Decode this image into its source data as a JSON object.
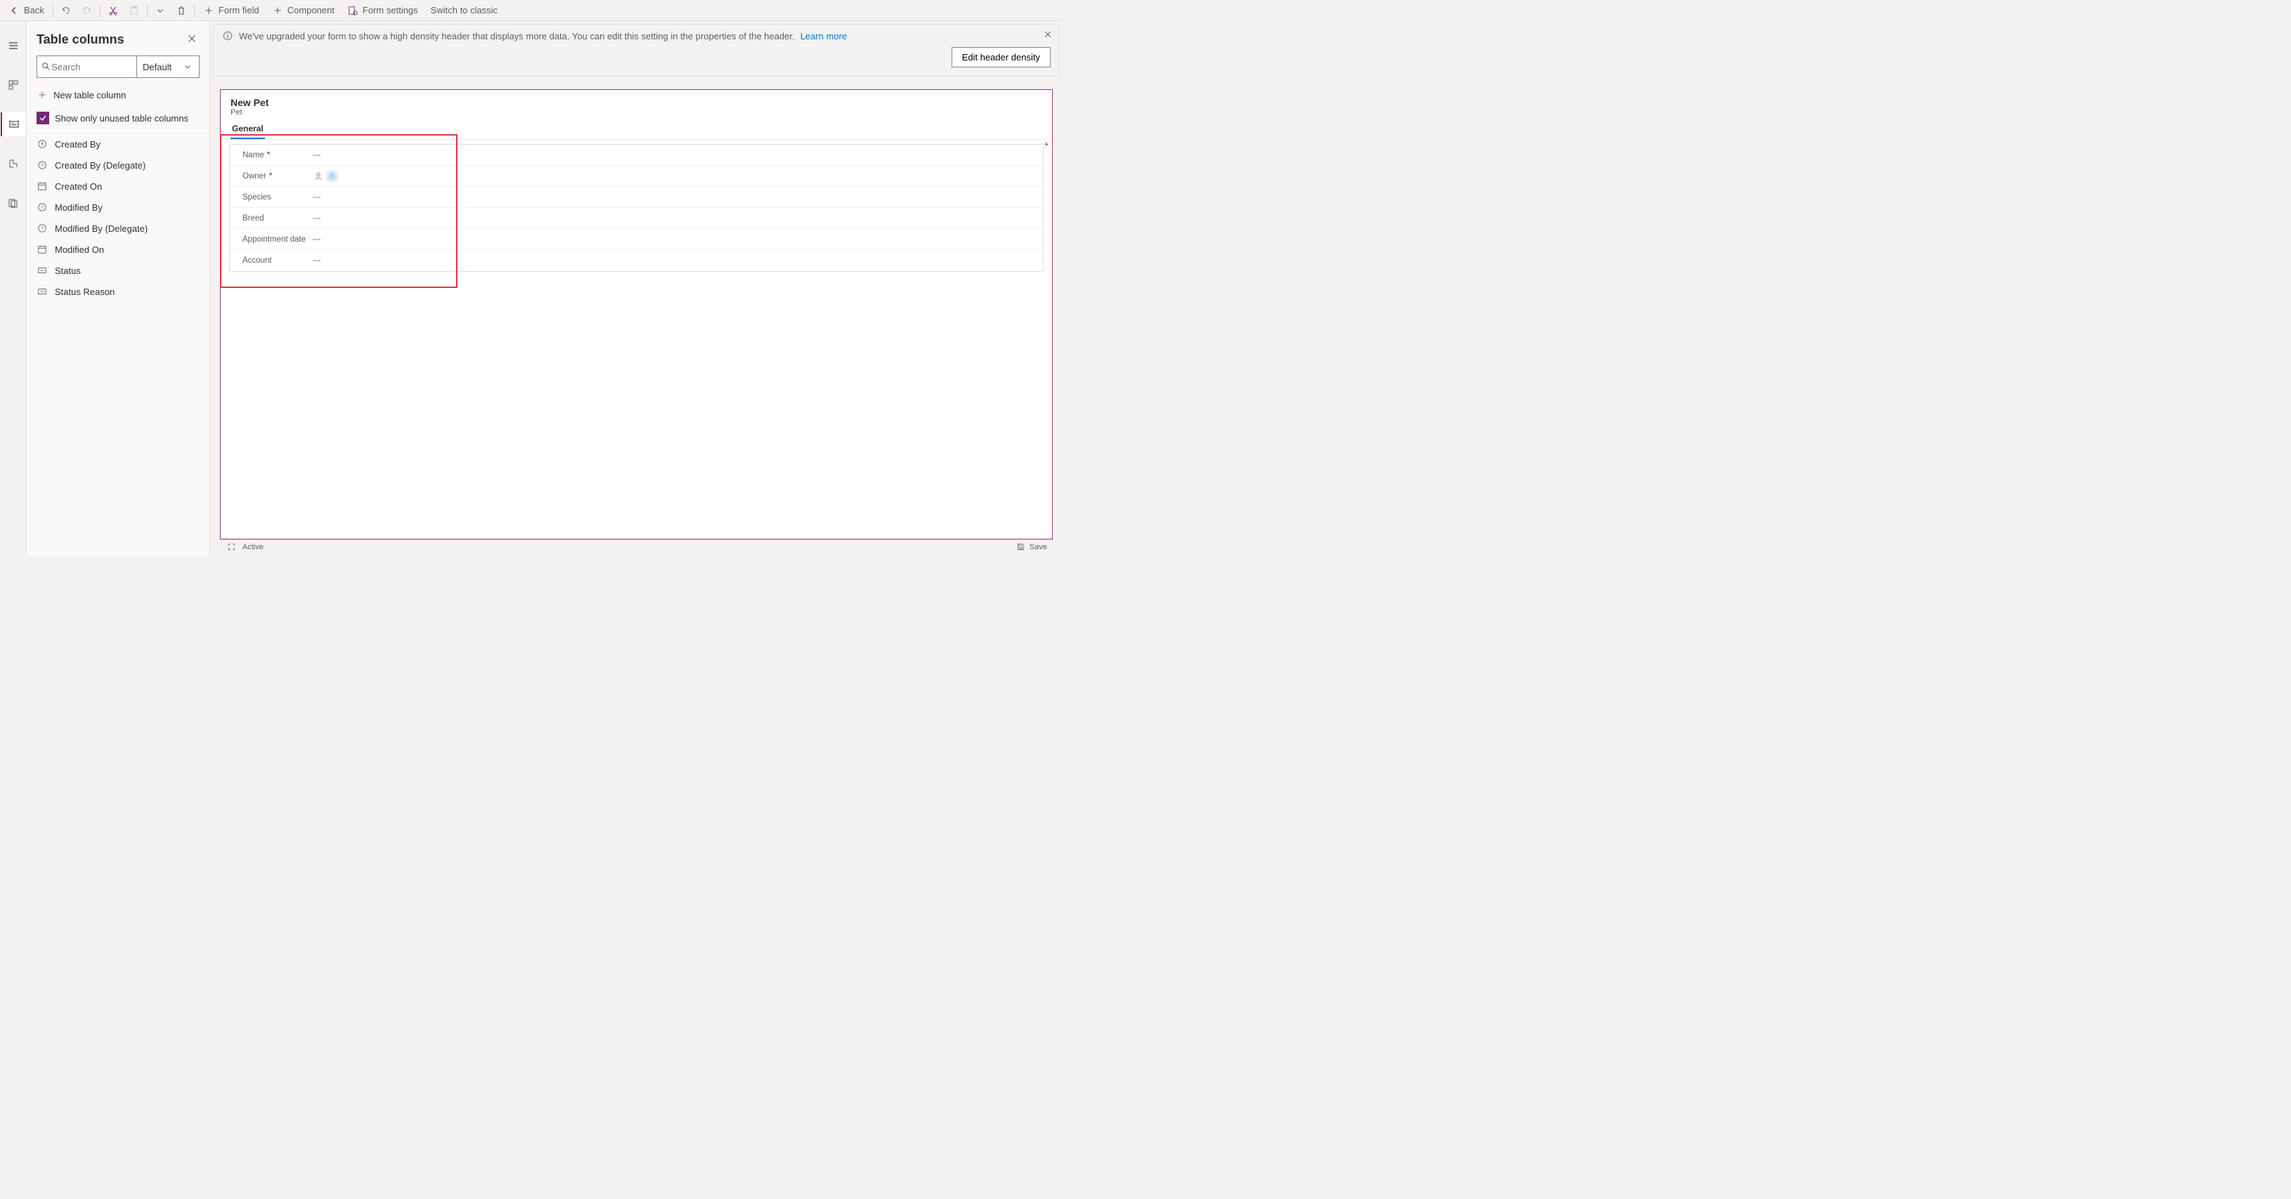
{
  "topbar": {
    "back": "Back",
    "form_field": "Form field",
    "component": "Component",
    "form_settings": "Form settings",
    "switch_classic": "Switch to classic"
  },
  "panel": {
    "title": "Table columns",
    "search_placeholder": "Search",
    "filter_label": "Default",
    "new_column": "New table column",
    "only_unused": "Show only unused table columns",
    "columns": [
      {
        "label": "Created By",
        "icon": "clock"
      },
      {
        "label": "Created By (Delegate)",
        "icon": "clock"
      },
      {
        "label": "Created On",
        "icon": "calendar"
      },
      {
        "label": "Modified By",
        "icon": "clock"
      },
      {
        "label": "Modified By (Delegate)",
        "icon": "clock"
      },
      {
        "label": "Modified On",
        "icon": "calendar"
      },
      {
        "label": "Status",
        "icon": "option"
      },
      {
        "label": "Status Reason",
        "icon": "option"
      }
    ]
  },
  "infobar": {
    "message": "We've upgraded your form to show a high density header that displays more data. You can edit this setting in the properties of the header.",
    "learn_more": "Learn more",
    "edit_density": "Edit header density"
  },
  "form": {
    "title": "New Pet",
    "entity": "Pet",
    "tab": "General",
    "fields": [
      {
        "label": "Name",
        "required": true,
        "value": "---"
      },
      {
        "label": "Owner",
        "required": true,
        "value_type": "owner",
        "value": "I"
      },
      {
        "label": "Species",
        "required": false,
        "value": "---"
      },
      {
        "label": "Breed",
        "required": false,
        "value": "---"
      },
      {
        "label": "Appointment date",
        "required": false,
        "value": "---"
      },
      {
        "label": "Account",
        "required": false,
        "value": "---"
      }
    ]
  },
  "statusbar": {
    "state": "Active",
    "save": "Save"
  }
}
